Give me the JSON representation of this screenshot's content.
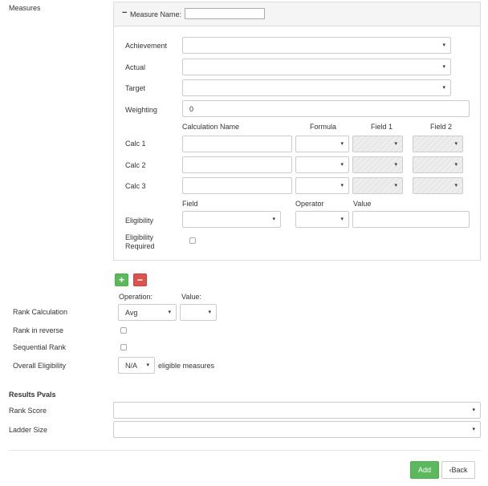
{
  "measures": {
    "section_label": "Measures",
    "collapse_symbol": "−",
    "name_label": "Measure Name:",
    "name_value": "",
    "rows": {
      "achievement": "Achievement",
      "actual": "Actual",
      "target": "Target",
      "weighting": "Weighting",
      "weighting_value": "0"
    },
    "calc_headers": {
      "name": "Calculation Name",
      "formula": "Formula",
      "field1": "Field 1",
      "field2": "Field 2"
    },
    "calcs": [
      "Calc 1",
      "Calc 2",
      "Calc 3"
    ],
    "elig_headers": {
      "field": "Field",
      "operator": "Operator",
      "value": "Value"
    },
    "eligibility": "Eligibility",
    "eligibility_required_line1": "Eligibility",
    "eligibility_required_line2": "Required"
  },
  "buttons": {
    "add_symbol": "+",
    "remove_symbol": "−",
    "add_label": "Add",
    "back_label": "Back"
  },
  "rank": {
    "operation_header": "Operation:",
    "value_header": "Value:",
    "calculation_label": "Rank Calculation",
    "operation_value": "Avg",
    "reverse_label": "Rank in reverse",
    "sequential_label": "Sequential Rank",
    "overall_label": "Overall Eligibility",
    "overall_value": "N/A",
    "overall_suffix": "eligible measures"
  },
  "results": {
    "header": "Results Pvals",
    "rank_score": "Rank Score",
    "ladder_size": "Ladder Size"
  },
  "icons": {
    "caret": "▾",
    "back_chevron": "‹"
  }
}
